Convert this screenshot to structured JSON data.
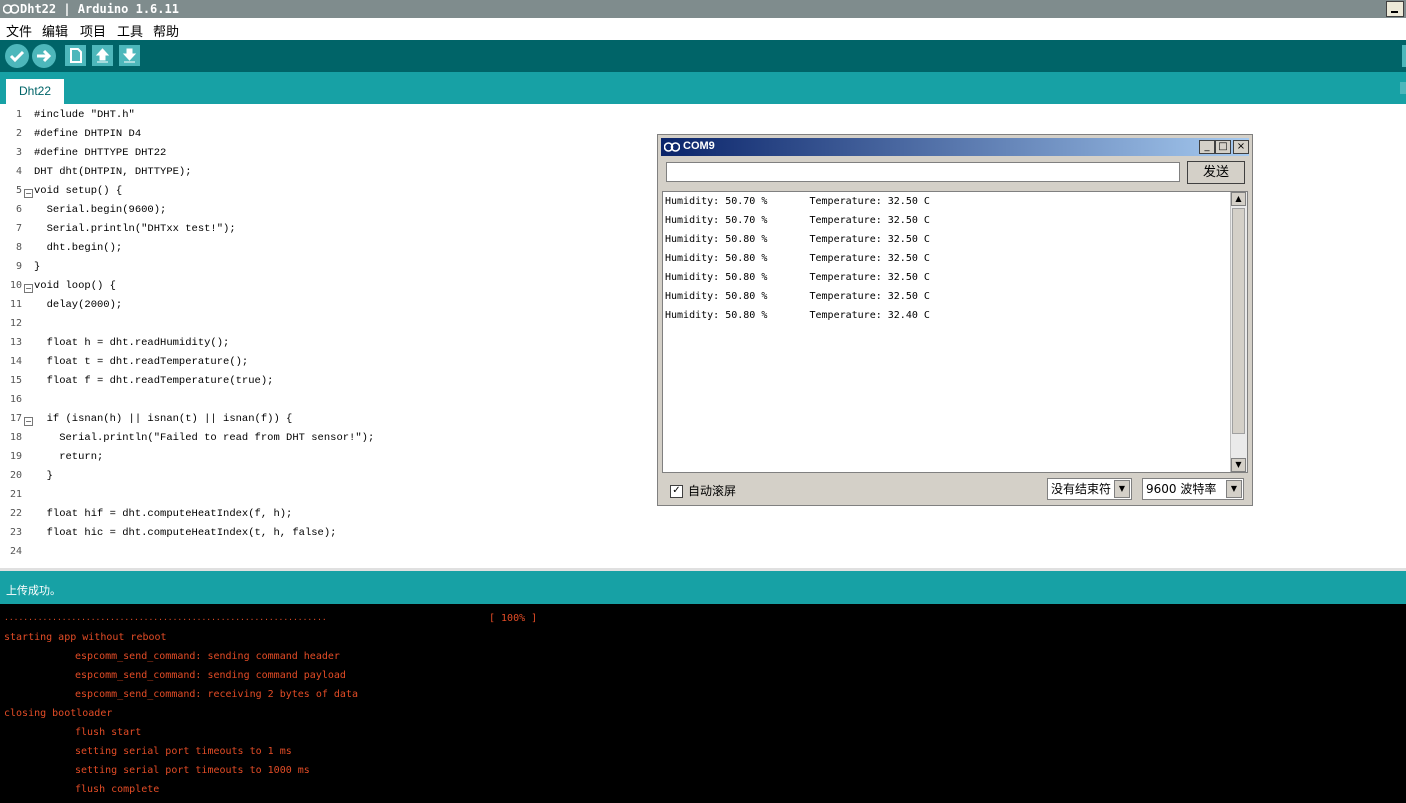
{
  "window": {
    "title": "Dht22 | Arduino 1.6.11"
  },
  "menu": [
    "文件",
    "编辑",
    "项目",
    "工具",
    "帮助"
  ],
  "toolbar": {
    "buttons": [
      "verify-icon",
      "upload-icon",
      "new-icon",
      "open-icon",
      "save-icon"
    ]
  },
  "tab": {
    "label": "Dht22"
  },
  "editor": {
    "line_numbers": [
      "1",
      "2",
      "3",
      "4",
      "5",
      "6",
      "7",
      "8",
      "9",
      "10",
      "11",
      "12",
      "13",
      "14",
      "15",
      "16",
      "17",
      "18",
      "19",
      "20",
      "21",
      "22",
      "23",
      "24"
    ],
    "lines": [
      "#include \"DHT.h\"",
      "#define DHTPIN D4",
      "#define DHTTYPE DHT22",
      "DHT dht(DHTPIN, DHTTYPE);",
      "void setup() {",
      "  Serial.begin(9600);",
      "  Serial.println(\"DHTxx test!\");",
      "  dht.begin();",
      "}",
      "void loop() {",
      "  delay(2000);",
      "",
      "  float h = dht.readHumidity();",
      "  float t = dht.readTemperature();",
      "  float f = dht.readTemperature(true);",
      "",
      "  if (isnan(h) || isnan(t) || isnan(f)) {",
      "    Serial.println(\"Failed to read from DHT sensor!\");",
      "    return;",
      "  }",
      "",
      "  float hif = dht.computeHeatIndex(f, h);",
      "  float hic = dht.computeHeatIndex(t, h, false);",
      ""
    ]
  },
  "status": {
    "message": "上传成功。"
  },
  "console": {
    "progress_dots": "...................................................................",
    "progress_pct": "[ 100% ]",
    "lines": [
      "starting app without reboot",
      "espcomm_send_command: sending command header",
      "espcomm_send_command: sending command payload",
      "espcomm_send_command: receiving 2 bytes of data",
      "closing bootloader",
      "flush start",
      "setting serial port timeouts to 1 ms",
      "setting serial port timeouts to 1000 ms",
      "flush complete"
    ]
  },
  "serial_monitor": {
    "title": "COM9",
    "send_label": "发送",
    "input_value": "",
    "output": [
      "Humidity: 50.70 %       Temperature: 32.50 C",
      "Humidity: 50.70 %       Temperature: 32.50 C",
      "Humidity: 50.80 %       Temperature: 32.50 C",
      "Humidity: 50.80 %       Temperature: 32.50 C",
      "Humidity: 50.80 %       Temperature: 32.50 C",
      "Humidity: 50.80 %       Temperature: 32.50 C",
      "Humidity: 50.80 %       Temperature: 32.40 C"
    ],
    "autoscroll_label": "自动滚屏",
    "autoscroll_checked": true,
    "line_ending": "没有结束符",
    "baud_rate": "9600 波特率"
  }
}
